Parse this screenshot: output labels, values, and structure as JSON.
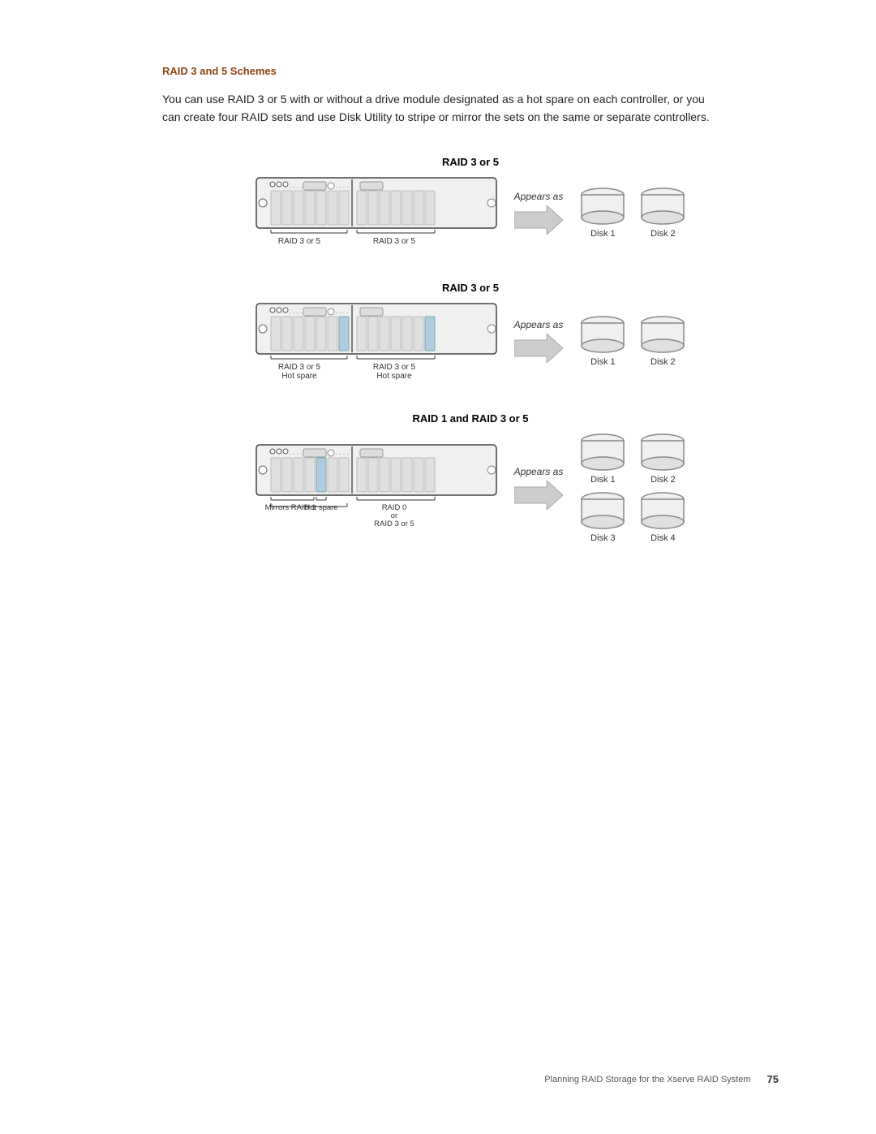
{
  "page": {
    "section_title": "RAID 3 and 5 Schemes",
    "body_text": "You can use RAID 3 or 5 with or without a drive module designated as a hot spare on each controller, or you can create four RAID sets and use Disk Utility to stripe or mirror the sets on the same or separate controllers.",
    "footer_text": "Planning RAID Storage for the Xserve RAID System",
    "page_number": "75"
  },
  "diagrams": [
    {
      "id": "diagram1",
      "title": "RAID 3 or 5",
      "left_label": "RAID 3 or 5",
      "right_label": "RAID 3 or 5",
      "sub_labels": [],
      "appears_as": "Appears\nas",
      "disks": [
        "Disk 1",
        "Disk 2"
      ],
      "has_highlight": false,
      "disk_count": 2
    },
    {
      "id": "diagram2",
      "title": "RAID 3 or 5",
      "left_label": "RAID 3 or 5",
      "right_label": "RAID 3 or 5",
      "sub_left": "Hot spare",
      "sub_right": "Hot spare",
      "appears_as": "Appears\nas",
      "disks": [
        "Disk 1",
        "Disk 2"
      ],
      "has_highlight": true,
      "disk_count": 2
    },
    {
      "id": "diagram3",
      "title": "RAID 1 and RAID 3 or 5",
      "left_label": "Mirrors RAID 1",
      "mid_label": "Hot spare",
      "right_label": "RAID 0\nor\nRAID 3 or 5",
      "appears_as": "Appears\nas",
      "disks": [
        "Disk 1",
        "Disk 2",
        "Disk 3",
        "Disk 4"
      ],
      "has_highlight": true,
      "disk_count": 4
    }
  ]
}
